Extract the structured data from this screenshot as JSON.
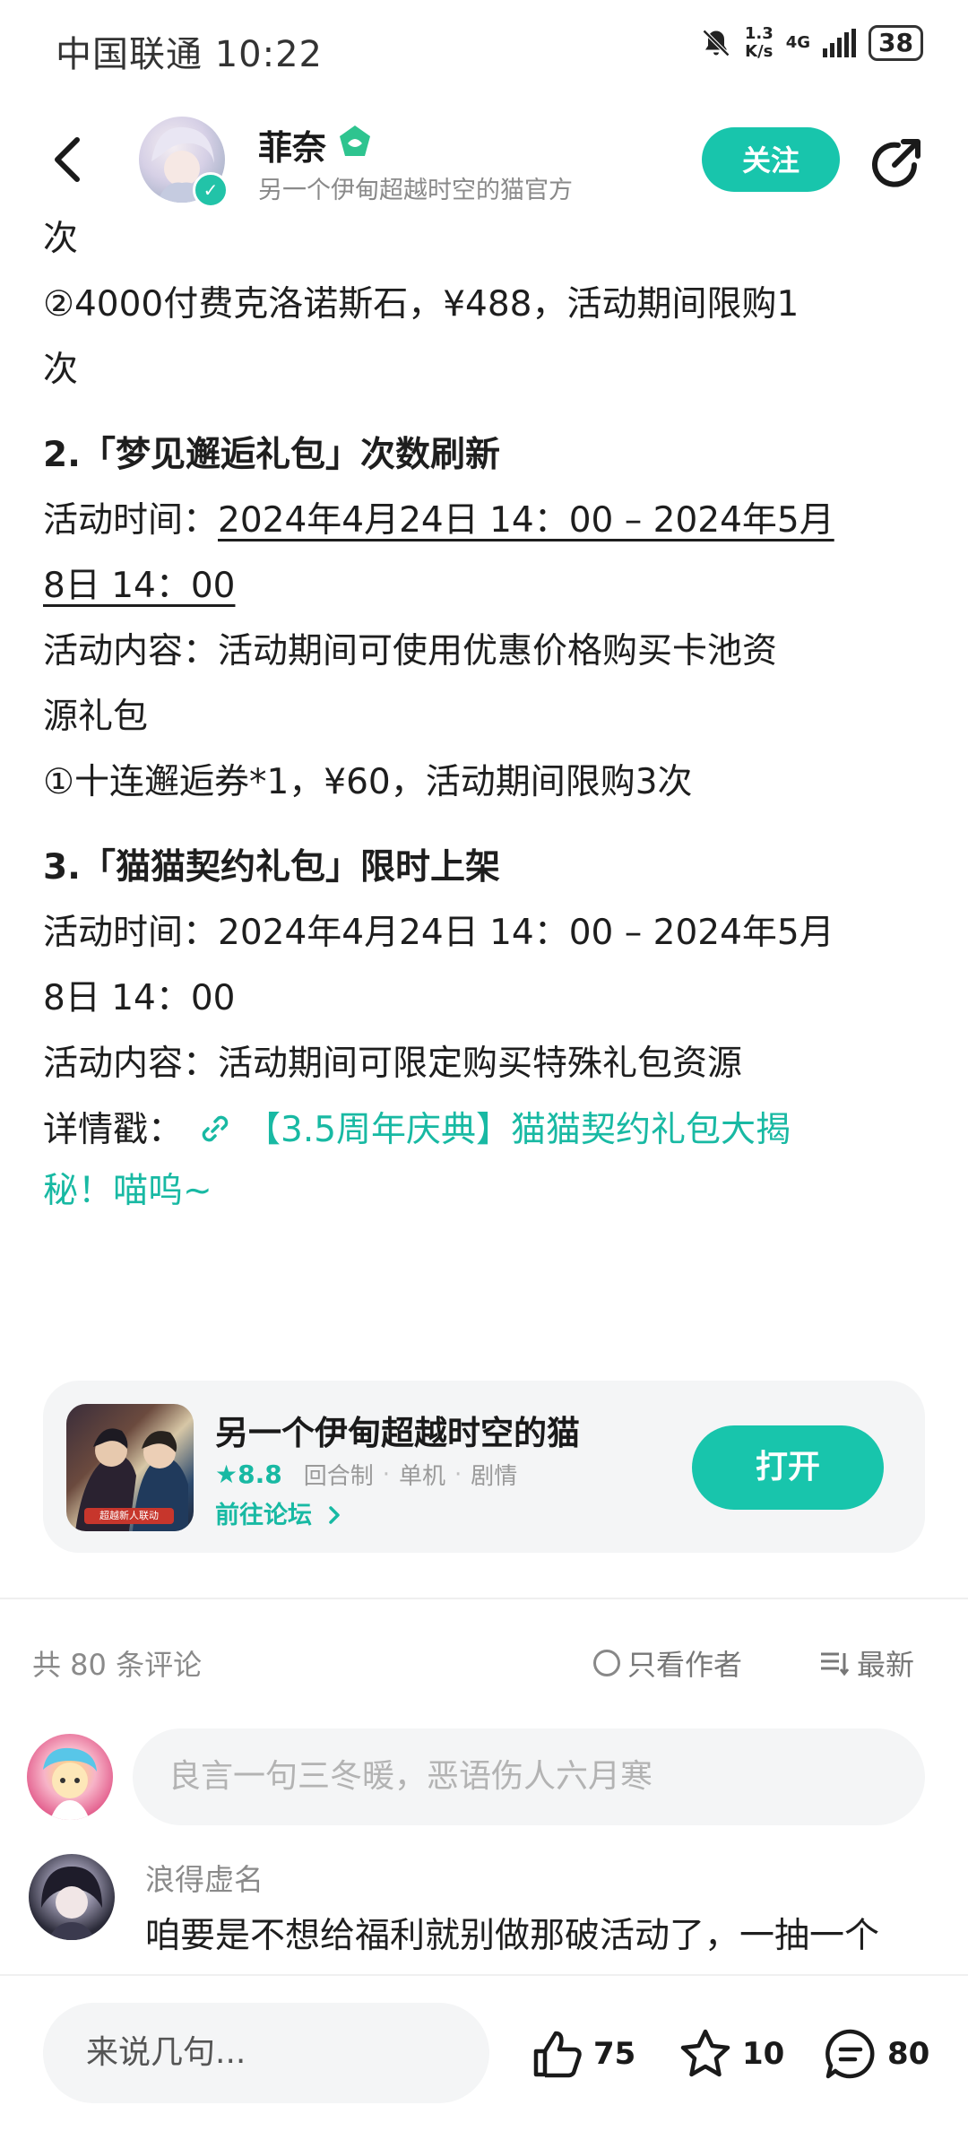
{
  "status_bar": {
    "carrier_time": "中国联通 10:22",
    "net_speed_top": "1.3",
    "net_speed_bottom": "K/s",
    "network": "4G",
    "battery": "38"
  },
  "header": {
    "author_name": "菲奈",
    "author_sub": "另一个伊甸超越时空的猫官方",
    "follow_label": "关注"
  },
  "article": {
    "line_cut": "①…",
    "line_01": "次",
    "line_02": "②4000付费克洛诺斯石，¥488，活动期间限购1",
    "line_03": "次",
    "section2_title": "2.「梦见邂逅礼包」次数刷新",
    "s2_time_label": "活动时间：",
    "s2_time_value_a": "2024年4月24日 14：00 – 2024年5月",
    "s2_time_value_b": "8日 14：00",
    "s2_content_a": "活动内容：活动期间可使用优惠价格购买卡池资",
    "s2_content_b": "源礼包",
    "s2_item": "①十连邂逅券*1，¥60，活动期间限购3次",
    "section3_title": "3.「猫猫契约礼包」限时上架",
    "s3_time_a": "活动时间：2024年4月24日 14：00 – 2024年5月",
    "s3_time_b": "8日 14：00",
    "s3_content": "活动内容：活动期间可限定购买特殊礼包资源",
    "detail_label": "详情戳：",
    "detail_link_a": "【3.5周年庆典】猫猫契约礼包大揭",
    "detail_link_b": "秘！喵呜~"
  },
  "game_card": {
    "title": "另一个伊甸超越时空的猫",
    "rating": "★8.8",
    "tags": [
      "回合制",
      "单机",
      "剧情"
    ],
    "forum_link": "前往论坛",
    "open_label": "打开",
    "cover_tag": "超越新人联动"
  },
  "comments": {
    "count_label": "共 80 条评论",
    "author_only_label": "只看作者",
    "sort_label": "最新",
    "input_placeholder": "良言一句三冬暖，恶语伤人六月寒",
    "items": [
      {
        "user": "浪得虚名",
        "text": "咱要是不想给福利就别做那破活动了，一抽一个",
        "text_cut": "…"
      }
    ]
  },
  "bottom_bar": {
    "input_placeholder": "来说几句...",
    "likes": "75",
    "favorites": "10",
    "comments": "80"
  },
  "colors": {
    "accent": "#18c5ac",
    "link": "#18b9a3"
  }
}
